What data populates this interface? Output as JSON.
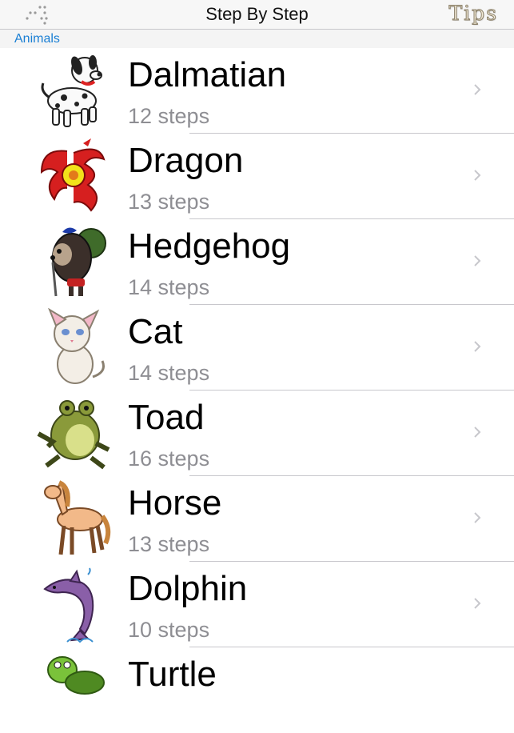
{
  "nav": {
    "title": "Step By Step",
    "tips_label": "Tips",
    "menu_icon": "dots-menu-icon"
  },
  "section": {
    "label": "Animals"
  },
  "items": [
    {
      "name": "Dalmatian",
      "steps": "12 steps",
      "icon": "dalmatian-icon"
    },
    {
      "name": "Dragon",
      "steps": "13 steps",
      "icon": "dragon-icon"
    },
    {
      "name": "Hedgehog",
      "steps": "14 steps",
      "icon": "hedgehog-icon"
    },
    {
      "name": "Cat",
      "steps": "14 steps",
      "icon": "cat-icon"
    },
    {
      "name": "Toad",
      "steps": "16 steps",
      "icon": "toad-icon"
    },
    {
      "name": "Horse",
      "steps": "13 steps",
      "icon": "horse-icon"
    },
    {
      "name": "Dolphin",
      "steps": "10 steps",
      "icon": "dolphin-icon"
    },
    {
      "name": "Turtle",
      "steps": "",
      "icon": "turtle-icon"
    }
  ],
  "colors": {
    "link_blue": "#1a7fd4",
    "subtitle_gray": "#8e8e93",
    "separator": "#c8c7cc"
  }
}
